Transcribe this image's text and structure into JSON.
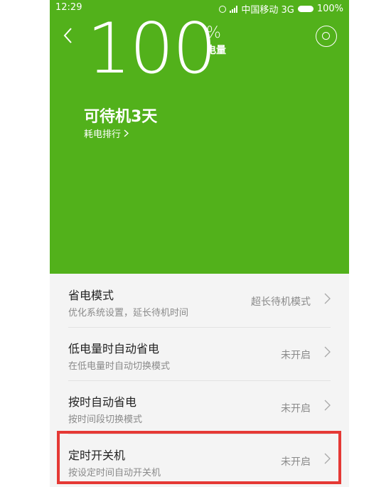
{
  "status": {
    "time": "12:29",
    "carrier": "中国移动 3G",
    "battery": "100%"
  },
  "header": {
    "battery_level": "100",
    "percent_sign": "%",
    "unit_label": "电量",
    "standby_text": "可待机3天",
    "ranking_link": "耗电排行"
  },
  "settings": [
    {
      "title": "省电模式",
      "subtitle": "优化系统设置，延长待机时间",
      "value": "超长待机模式"
    },
    {
      "title": "低电量时自动省电",
      "subtitle": "在低电量时自动切换模式",
      "value": "未开启"
    },
    {
      "title": "按时自动省电",
      "subtitle": "按时间段切换模式",
      "value": "未开启"
    },
    {
      "title": "定时开关机",
      "subtitle": "按设定时间自动开关机",
      "value": "未开启"
    }
  ],
  "icons": {
    "back": "chevron-left-icon",
    "settings": "gear-icon",
    "row_arrow": "chevron-right-icon",
    "alarm": "alarm-icon",
    "signal": "signal-icon",
    "battery": "battery-icon"
  },
  "colors": {
    "accent": "#52b11b",
    "highlight": "#e53935",
    "background": "#f4f4f4"
  }
}
